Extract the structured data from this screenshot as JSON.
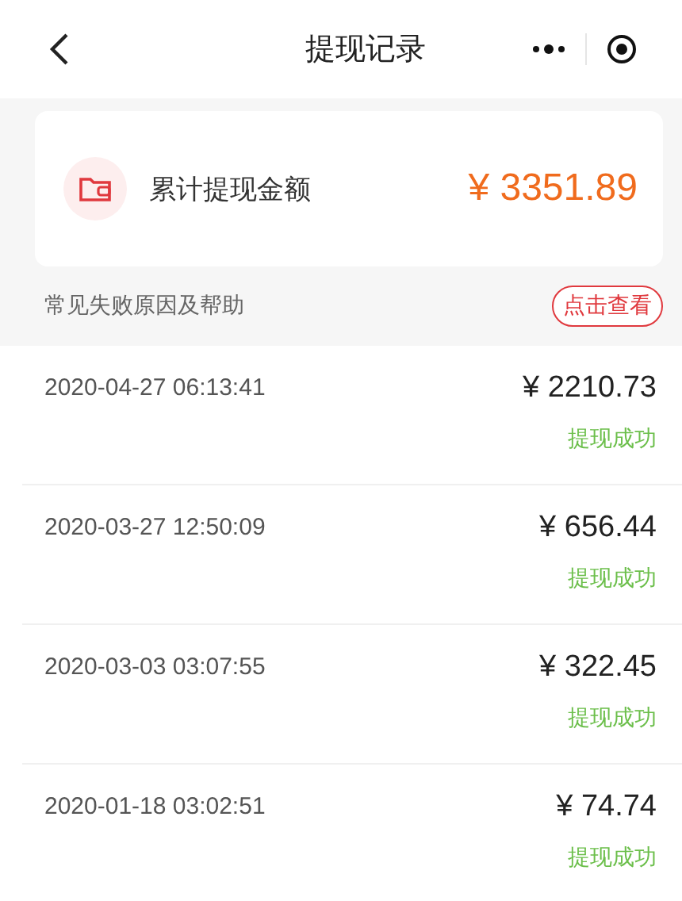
{
  "nav": {
    "title": "提现记录"
  },
  "summary": {
    "label": "累计提现金额",
    "amount": "¥ 3351.89"
  },
  "help": {
    "text": "常见失败原因及帮助",
    "button": "点击查看"
  },
  "records": [
    {
      "time": "2020-04-27 06:13:41",
      "amount": "¥ 2210.73",
      "status": {
        "text": "提现成功",
        "kind": "success"
      }
    },
    {
      "time": "2020-03-27 12:50:09",
      "amount": "¥ 656.44",
      "status": {
        "text": "提现成功",
        "kind": "success"
      }
    },
    {
      "time": "2020-03-03 03:07:55",
      "amount": "¥ 322.45",
      "status": {
        "text": "提现成功",
        "kind": "success"
      }
    },
    {
      "time": "2020-01-18 03:02:51",
      "amount": "¥ 74.74",
      "status": {
        "text": "提现成功",
        "kind": "success"
      }
    }
  ]
}
